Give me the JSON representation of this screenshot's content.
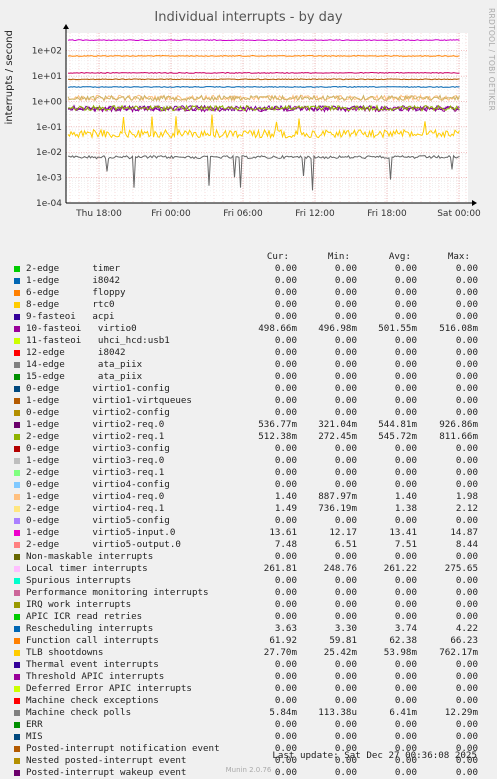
{
  "title": "Individual interrupts - by day",
  "side_label": "RRDTOOL / TOBI OETIKER",
  "chart_data": {
    "type": "line",
    "title": "Individual interrupts - by day",
    "ylabel": "interrupts / second",
    "yscale": "log",
    "ylim": [
      0.0001,
      500
    ],
    "y_ticks": [
      "1e+02",
      "1e+01",
      "1e+00",
      "1e-01",
      "1e-02",
      "1e-03",
      "1e-04"
    ],
    "x_ticks": [
      "Thu 18:00",
      "Fri 00:00",
      "Fri 06:00",
      "Fri 12:00",
      "Fri 18:00",
      "Sat 00:00"
    ],
    "grid": true,
    "series_levels": [
      {
        "name": "Function call interrupts",
        "color": "#ff8000",
        "value": 62.38
      },
      {
        "name": "Machine check polls",
        "color": "#666666",
        "value": 0.00641
      },
      {
        "name": "Local timer interrupts",
        "color": "#cc00cc",
        "value": 261.22
      },
      {
        "name": "Rescheduling interrupts",
        "color": "#0066b3",
        "value": 3.74
      },
      {
        "name": "virtio0",
        "color": "#990099",
        "value": 0.50155
      },
      {
        "name": "virtio2-req.0",
        "color": "#7a0099",
        "value": 0.5448
      },
      {
        "name": "virtio2-req.1",
        "color": "#8fb300",
        "value": 0.54572
      },
      {
        "name": "virtio4-req.0",
        "color": "#ffbf80",
        "value": 1.4
      },
      {
        "name": "virtio4-req.1",
        "color": "#ccb366",
        "value": 1.38
      },
      {
        "name": "virtio5-input.0",
        "color": "#cc0066",
        "value": 13.41
      },
      {
        "name": "virtio5-output.0",
        "color": "#b35900",
        "value": 7.51
      },
      {
        "name": "TLB shootdowns",
        "color": "#ffcc00",
        "value": 0.05398
      }
    ]
  },
  "legend_header": {
    "cur": "Cur:",
    "min": "Min:",
    "avg": "Avg:",
    "max": "Max:"
  },
  "legend": [
    {
      "label": "2-edge      timer",
      "color": "#00cc00",
      "cur": "0.00",
      "min": "0.00",
      "avg": "0.00",
      "max": "0.00"
    },
    {
      "label": "1-edge      i8042",
      "color": "#0066b3",
      "cur": "0.00",
      "min": "0.00",
      "avg": "0.00",
      "max": "0.00"
    },
    {
      "label": "6-edge      floppy",
      "color": "#ff8000",
      "cur": "0.00",
      "min": "0.00",
      "avg": "0.00",
      "max": "0.00"
    },
    {
      "label": "8-edge      rtc0",
      "color": "#ffcc00",
      "cur": "0.00",
      "min": "0.00",
      "avg": "0.00",
      "max": "0.00"
    },
    {
      "label": "9-fasteoi   acpi",
      "color": "#330099",
      "cur": "0.00",
      "min": "0.00",
      "avg": "0.00",
      "max": "0.00"
    },
    {
      "label": "10-fasteoi   virtio0",
      "color": "#990099",
      "cur": "498.66m",
      "min": "496.98m",
      "avg": "501.55m",
      "max": "516.08m"
    },
    {
      "label": "11-fasteoi   uhci_hcd:usb1",
      "color": "#ccff00",
      "cur": "0.00",
      "min": "0.00",
      "avg": "0.00",
      "max": "0.00"
    },
    {
      "label": "12-edge      i8042",
      "color": "#ff0000",
      "cur": "0.00",
      "min": "0.00",
      "avg": "0.00",
      "max": "0.00"
    },
    {
      "label": "14-edge      ata_piix",
      "color": "#808080",
      "cur": "0.00",
      "min": "0.00",
      "avg": "0.00",
      "max": "0.00"
    },
    {
      "label": "15-edge      ata_piix",
      "color": "#008f00",
      "cur": "0.00",
      "min": "0.00",
      "avg": "0.00",
      "max": "0.00"
    },
    {
      "label": "0-edge      virtio1-config",
      "color": "#00487d",
      "cur": "0.00",
      "min": "0.00",
      "avg": "0.00",
      "max": "0.00"
    },
    {
      "label": "1-edge      virtio1-virtqueues",
      "color": "#b35a00",
      "cur": "0.00",
      "min": "0.00",
      "avg": "0.00",
      "max": "0.00"
    },
    {
      "label": "0-edge      virtio2-config",
      "color": "#b38f00",
      "cur": "0.00",
      "min": "0.00",
      "avg": "0.00",
      "max": "0.00"
    },
    {
      "label": "1-edge      virtio2-req.0",
      "color": "#6b006b",
      "cur": "536.77m",
      "min": "321.04m",
      "avg": "544.81m",
      "max": "926.86m"
    },
    {
      "label": "2-edge      virtio2-req.1",
      "color": "#8fb300",
      "cur": "512.38m",
      "min": "272.45m",
      "avg": "545.72m",
      "max": "811.66m"
    },
    {
      "label": "0-edge      virtio3-config",
      "color": "#b30000",
      "cur": "0.00",
      "min": "0.00",
      "avg": "0.00",
      "max": "0.00"
    },
    {
      "label": "1-edge      virtio3-req.0",
      "color": "#bebebe",
      "cur": "0.00",
      "min": "0.00",
      "avg": "0.00",
      "max": "0.00"
    },
    {
      "label": "2-edge      virtio3-req.1",
      "color": "#80ff80",
      "cur": "0.00",
      "min": "0.00",
      "avg": "0.00",
      "max": "0.00"
    },
    {
      "label": "0-edge      virtio4-config",
      "color": "#80c9ff",
      "cur": "0.00",
      "min": "0.00",
      "avg": "0.00",
      "max": "0.00"
    },
    {
      "label": "1-edge      virtio4-req.0",
      "color": "#ffc080",
      "cur": "1.40",
      "min": "887.97m",
      "avg": "1.40",
      "max": "1.98"
    },
    {
      "label": "2-edge      virtio4-req.1",
      "color": "#ffe680",
      "cur": "1.49",
      "min": "736.19m",
      "avg": "1.38",
      "max": "2.12"
    },
    {
      "label": "0-edge      virtio5-config",
      "color": "#aa80ff",
      "cur": "0.00",
      "min": "0.00",
      "avg": "0.00",
      "max": "0.00"
    },
    {
      "label": "1-edge      virtio5-input.0",
      "color": "#ee00cc",
      "cur": "13.61",
      "min": "12.17",
      "avg": "13.41",
      "max": "14.87"
    },
    {
      "label": "2-edge      virtio5-output.0",
      "color": "#ff8080",
      "cur": "7.48",
      "min": "6.51",
      "avg": "7.51",
      "max": "8.44"
    },
    {
      "label": "Non-maskable interrupts",
      "color": "#666600",
      "cur": "0.00",
      "min": "0.00",
      "avg": "0.00",
      "max": "0.00"
    },
    {
      "label": "Local timer interrupts",
      "color": "#ffbfff",
      "cur": "261.81",
      "min": "248.76",
      "avg": "261.22",
      "max": "275.65"
    },
    {
      "label": "Spurious interrupts",
      "color": "#00ffcc",
      "cur": "0.00",
      "min": "0.00",
      "avg": "0.00",
      "max": "0.00"
    },
    {
      "label": "Performance monitoring interrupts",
      "color": "#cc6699",
      "cur": "0.00",
      "min": "0.00",
      "avg": "0.00",
      "max": "0.00"
    },
    {
      "label": "IRQ work interrupts",
      "color": "#999900",
      "cur": "0.00",
      "min": "0.00",
      "avg": "0.00",
      "max": "0.00"
    },
    {
      "label": "APIC ICR read retries",
      "color": "#00cc00",
      "cur": "0.00",
      "min": "0.00",
      "avg": "0.00",
      "max": "0.00"
    },
    {
      "label": "Rescheduling interrupts",
      "color": "#0066b3",
      "cur": "3.63",
      "min": "3.30",
      "avg": "3.74",
      "max": "4.22"
    },
    {
      "label": "Function call interrupts",
      "color": "#ff8000",
      "cur": "61.92",
      "min": "59.81",
      "avg": "62.38",
      "max": "66.23"
    },
    {
      "label": "TLB shootdowns",
      "color": "#ffcc00",
      "cur": "27.70m",
      "min": "25.42m",
      "avg": "53.98m",
      "max": "762.17m"
    },
    {
      "label": "Thermal event interrupts",
      "color": "#330099",
      "cur": "0.00",
      "min": "0.00",
      "avg": "0.00",
      "max": "0.00"
    },
    {
      "label": "Threshold APIC interrupts",
      "color": "#990099",
      "cur": "0.00",
      "min": "0.00",
      "avg": "0.00",
      "max": "0.00"
    },
    {
      "label": "Deferred Error APIC interrupts",
      "color": "#ccff00",
      "cur": "0.00",
      "min": "0.00",
      "avg": "0.00",
      "max": "0.00"
    },
    {
      "label": "Machine check exceptions",
      "color": "#ff0000",
      "cur": "0.00",
      "min": "0.00",
      "avg": "0.00",
      "max": "0.00"
    },
    {
      "label": "Machine check polls",
      "color": "#808080",
      "cur": "5.84m",
      "min": "113.38u",
      "avg": "6.41m",
      "max": "12.29m"
    },
    {
      "label": "ERR",
      "color": "#008f00",
      "cur": "0.00",
      "min": "0.00",
      "avg": "0.00",
      "max": "0.00"
    },
    {
      "label": "MIS",
      "color": "#00487d",
      "cur": "0.00",
      "min": "0.00",
      "avg": "0.00",
      "max": "0.00"
    },
    {
      "label": "Posted-interrupt notification event",
      "color": "#b35a00",
      "cur": "0.00",
      "min": "0.00",
      "avg": "0.00",
      "max": "0.00"
    },
    {
      "label": "Nested posted-interrupt event",
      "color": "#b38f00",
      "cur": "0.00",
      "min": "0.00",
      "avg": "0.00",
      "max": "0.00"
    },
    {
      "label": "Posted-interrupt wakeup event",
      "color": "#6b006b",
      "cur": "0.00",
      "min": "0.00",
      "avg": "0.00",
      "max": "0.00"
    }
  ],
  "footer": "Last update: Sat Dec 27 00:36:08 2025",
  "munin": "Munin 2.0.76"
}
